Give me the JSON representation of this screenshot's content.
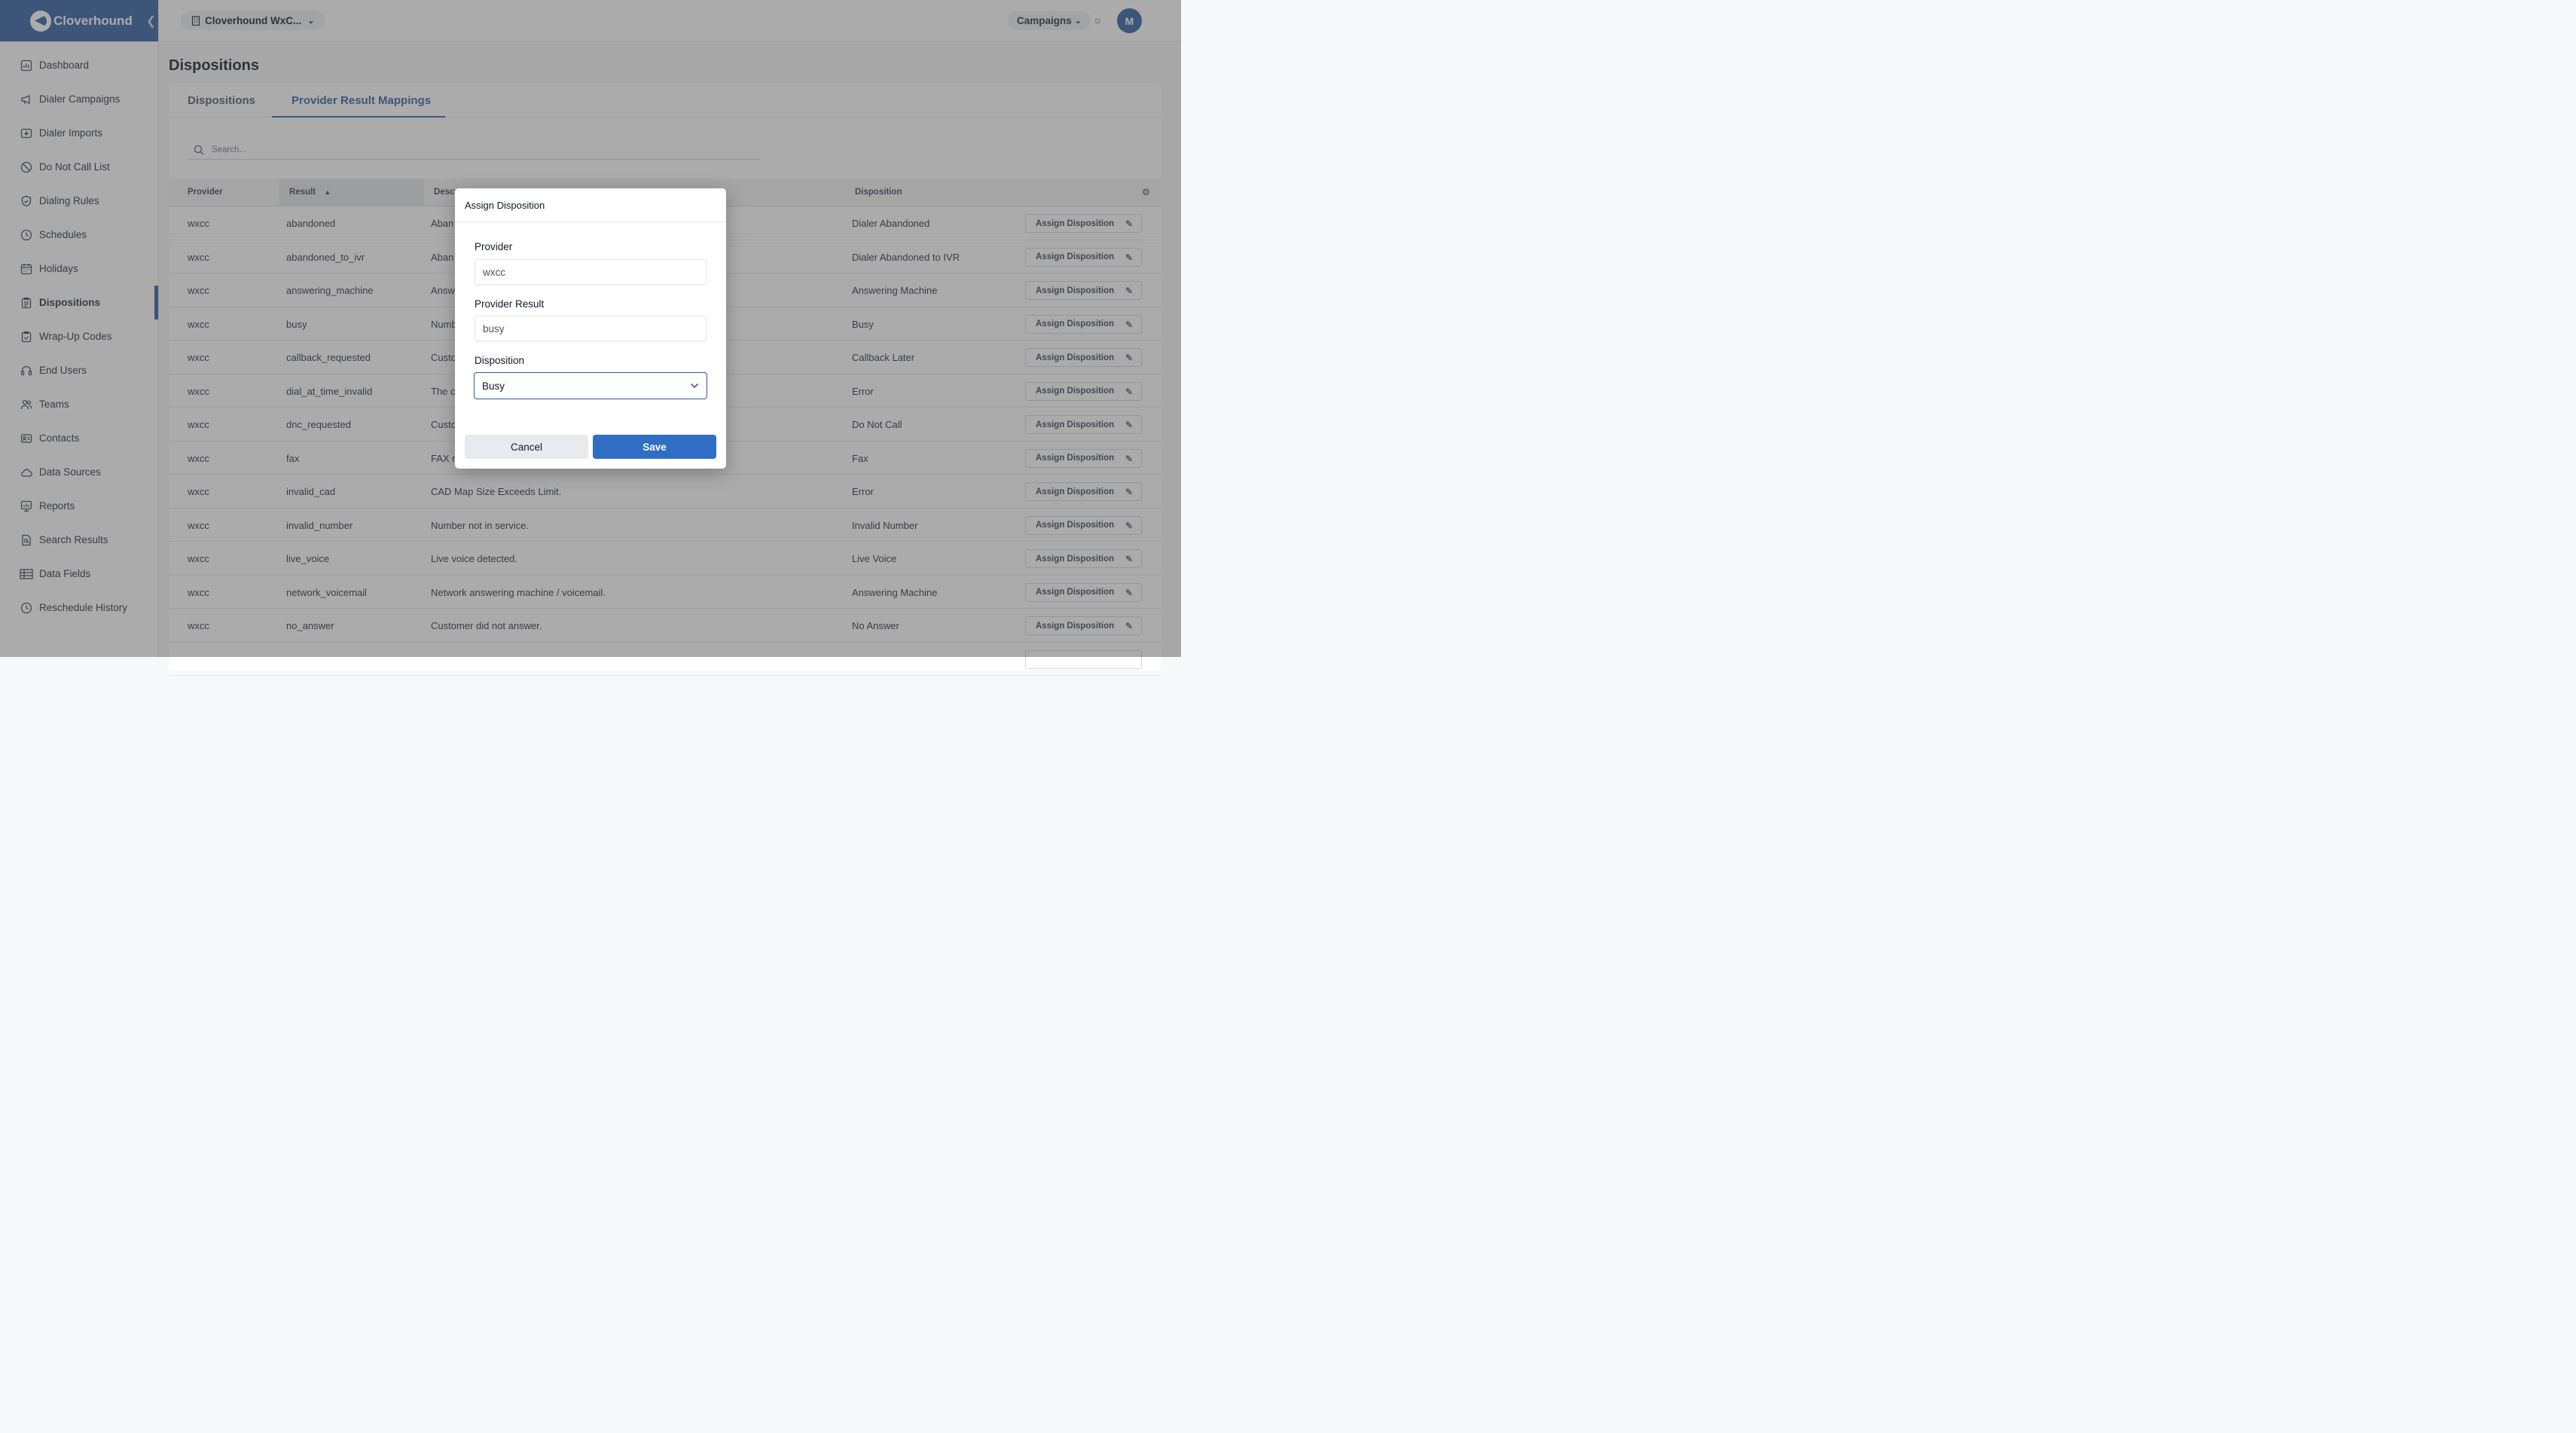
{
  "brand": {
    "name": "Cloverhound"
  },
  "topbar": {
    "org_label": "Cloverhound WxC...",
    "campaigns_label": "Campaigns",
    "avatar_initial": "M"
  },
  "sidebar": {
    "items": [
      {
        "label": "Dashboard",
        "icon": "dashboard-icon"
      },
      {
        "label": "Dialer Campaigns",
        "icon": "megaphone-icon"
      },
      {
        "label": "Dialer Imports",
        "icon": "import-icon"
      },
      {
        "label": "Do Not Call List",
        "icon": "ban-icon"
      },
      {
        "label": "Dialing Rules",
        "icon": "shield-check-icon"
      },
      {
        "label": "Schedules",
        "icon": "clock-icon"
      },
      {
        "label": "Holidays",
        "icon": "calendar-icon"
      },
      {
        "label": "Dispositions",
        "icon": "clipboard-icon",
        "active": true
      },
      {
        "label": "Wrap-Up Codes",
        "icon": "clipboard-check-icon"
      },
      {
        "label": "End Users",
        "icon": "headset-icon"
      },
      {
        "label": "Teams",
        "icon": "users-icon"
      },
      {
        "label": "Contacts",
        "icon": "contact-card-icon"
      },
      {
        "label": "Data Sources",
        "icon": "cloud-icon"
      },
      {
        "label": "Reports",
        "icon": "report-icon"
      },
      {
        "label": "Search Results",
        "icon": "search-file-icon"
      },
      {
        "label": "Data Fields",
        "icon": "table-icon"
      },
      {
        "label": "Reschedule History",
        "icon": "history-icon"
      }
    ]
  },
  "page": {
    "title": "Dispositions"
  },
  "tabs": {
    "dispositions": "Dispositions",
    "mappings": "Provider Result Mappings"
  },
  "search": {
    "placeholder": "Search..."
  },
  "table": {
    "headers": {
      "provider": "Provider",
      "result": "Result",
      "description": "Desc",
      "disposition": "Disposition"
    },
    "action_label": "Assign Disposition",
    "rows": [
      {
        "provider": "wxcc",
        "result": "abandoned",
        "description": "Aban",
        "disposition": "Dialer Abandoned"
      },
      {
        "provider": "wxcc",
        "result": "abandoned_to_ivr",
        "description": "Aban",
        "disposition": "Dialer Abandoned to IVR"
      },
      {
        "provider": "wxcc",
        "result": "answering_machine",
        "description": "Answ",
        "disposition": "Answering Machine"
      },
      {
        "provider": "wxcc",
        "result": "busy",
        "description": "Numb",
        "disposition": "Busy"
      },
      {
        "provider": "wxcc",
        "result": "callback_requested",
        "description": "Custo",
        "disposition": "Callback Later"
      },
      {
        "provider": "wxcc",
        "result": "dial_at_time_invalid",
        "description": "The c",
        "disposition": "Error"
      },
      {
        "provider": "wxcc",
        "result": "dnc_requested",
        "description": "Custo",
        "disposition": "Do Not Call"
      },
      {
        "provider": "wxcc",
        "result": "fax",
        "description": "FAX r",
        "disposition": "Fax"
      },
      {
        "provider": "wxcc",
        "result": "invalid_cad",
        "description": "CAD Map Size Exceeds Limit.",
        "disposition": "Error"
      },
      {
        "provider": "wxcc",
        "result": "invalid_number",
        "description": "Number not in service.",
        "disposition": "Invalid Number"
      },
      {
        "provider": "wxcc",
        "result": "live_voice",
        "description": "Live voice detected.",
        "disposition": "Live Voice"
      },
      {
        "provider": "wxcc",
        "result": "network_voicemail",
        "description": "Network answering machine / voicemail.",
        "disposition": "Answering Machine"
      },
      {
        "provider": "wxcc",
        "result": "no_answer",
        "description": "Customer did not answer.",
        "disposition": "No Answer"
      }
    ]
  },
  "modal": {
    "title": "Assign Disposition",
    "provider_label": "Provider",
    "provider_value": "wxcc",
    "result_label": "Provider Result",
    "result_value": "busy",
    "disposition_label": "Disposition",
    "disposition_value": "Busy",
    "cancel_label": "Cancel",
    "save_label": "Save"
  },
  "colors": {
    "brand": "#2c5aa0",
    "save": "#2f6ec4",
    "overlay": "rgba(80,80,80,0.48)"
  }
}
